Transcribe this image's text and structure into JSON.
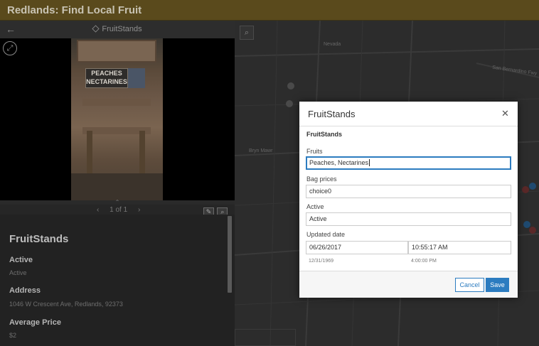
{
  "app": {
    "title": "Redlands: Find Local Fruit"
  },
  "panel": {
    "back_icon": "arrow-left-icon",
    "layer_icon": "layers-icon",
    "layer_title": "FruitStands",
    "expand_icon": "expand-icon",
    "photo_sign_text": "PEACHES NECTARINES",
    "pager": {
      "prev": "‹",
      "text": "1 of 1",
      "next": "›"
    },
    "collapse_glyph": "⌃",
    "tools": {
      "edit_icon": "pencil-icon",
      "zoom_icon": "zoom-to-icon"
    }
  },
  "details": {
    "title": "FruitStands",
    "fields": [
      {
        "label": "Active",
        "value": "Active"
      },
      {
        "label": "Address",
        "value": "1046 W Crescent Ave, Redlands, 92373"
      },
      {
        "label": "Average Price",
        "value": "$2"
      }
    ]
  },
  "map": {
    "search_icon": "search-icon",
    "labels": [
      "Nevada",
      "San Bernardino Fwy",
      "Bryn Mawr"
    ]
  },
  "modal": {
    "title": "FruitStands",
    "close_icon": "close-icon",
    "subtitle": "FruitStands",
    "fields": {
      "fruits": {
        "label": "Fruits",
        "value": "Peaches, Nectarines"
      },
      "bag_prices": {
        "label": "Bag prices",
        "value": "choice0"
      },
      "active": {
        "label": "Active",
        "value": "Active"
      },
      "updated_date": {
        "label": "Updated date",
        "date": "06/26/2017",
        "time": "10:55:17 AM",
        "date_hint": "12/31/1969",
        "time_hint": "4:00:00 PM"
      }
    },
    "buttons": {
      "cancel": "Cancel",
      "save": "Save"
    }
  },
  "colors": {
    "accent": "#2c7cc0",
    "header": "#5a4a1c"
  }
}
